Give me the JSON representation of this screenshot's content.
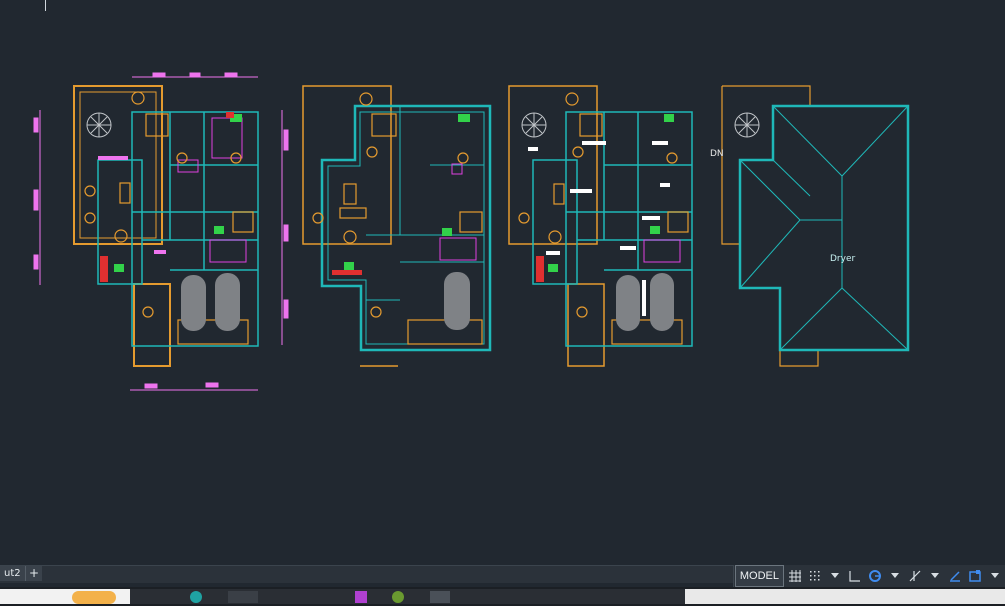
{
  "canvas": {
    "room_label": "Dryer",
    "stair_label": "DN"
  },
  "layout_bar": {
    "tab_label": "ut2",
    "add_label": "+"
  },
  "status_bar": {
    "model_label": "MODEL",
    "icons": [
      "grid-icon",
      "snap-icon",
      "dropdown-icon",
      "ortho-icon",
      "polar-icon",
      "dropdown-icon",
      "osnap-icon",
      "dropdown-icon",
      "annotate-icon",
      "workspace-icon",
      "dropdown-icon"
    ]
  },
  "colors": {
    "background": "#212830",
    "wall_orange": "#e59b2f",
    "wall_cyan": "#1fb8b8",
    "furniture_magenta": "#e040e0",
    "dimension_pink": "#ee74ee",
    "accent_green": "#32d24a",
    "accent_red": "#e03030"
  }
}
